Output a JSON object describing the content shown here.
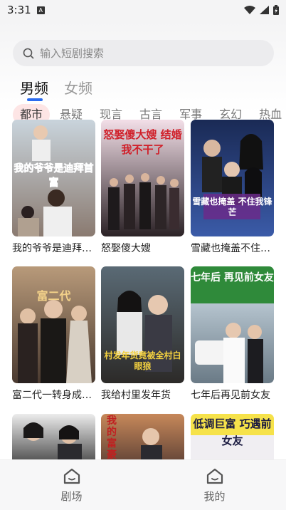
{
  "status_bar": {
    "time": "3:31",
    "notification_letter": "A"
  },
  "search": {
    "placeholder": "输入短剧搜索"
  },
  "gender_tabs": [
    {
      "label": "男频",
      "active": true
    },
    {
      "label": "女频",
      "active": false
    }
  ],
  "categories": [
    {
      "label": "都市",
      "active": true
    },
    {
      "label": "悬疑",
      "active": false
    },
    {
      "label": "现言",
      "active": false
    },
    {
      "label": "古言",
      "active": false
    },
    {
      "label": "军事",
      "active": false
    },
    {
      "label": "玄幻",
      "active": false
    },
    {
      "label": "热血",
      "active": false
    }
  ],
  "dramas": [
    {
      "title": "我的爷爷是迪拜首富",
      "poster_text": "我的爷爷是迪拜首富",
      "colors": [
        "#c9d4dc",
        "#8a7a70"
      ]
    },
    {
      "title": "怒娶傻大嫂",
      "poster_text": "怒娶傻大嫂 结婚我不干了",
      "colors": [
        "#f3dfe8",
        "#2b2226"
      ]
    },
    {
      "title": "雪藏也掩盖不住锋芒",
      "poster_text": "雪藏也掩盖 不住我锋芒",
      "colors": [
        "#1a2a55",
        "#3b5ba8"
      ]
    },
    {
      "title": "富二代一转身成了首富",
      "poster_text": "富二代",
      "colors": [
        "#b89a7a",
        "#4a3a30"
      ]
    },
    {
      "title": "我给村里发年货",
      "poster_text": "村发年货竟被全村白眼狼",
      "colors": [
        "#5a6a75",
        "#2c2a28"
      ]
    },
    {
      "title": "七年后再见前女友",
      "poster_text": "七年后 再见前女友",
      "colors": [
        "#d8e6f0",
        "#6a7a86"
      ]
    },
    {
      "title": "",
      "poster_text": "",
      "colors": [
        "#ececec",
        "#5a5a5a"
      ]
    },
    {
      "title": "",
      "poster_text": "我的富豪",
      "colors": [
        "#c7885a",
        "#6b4a3a"
      ]
    },
    {
      "title": "",
      "poster_text": "低调巨富 巧遇前女友",
      "colors": [
        "#f0eef2",
        "#3a3a4a"
      ]
    }
  ],
  "bottom_nav": [
    {
      "label": "剧场",
      "icon": "home-icon"
    },
    {
      "label": "我的",
      "icon": "home-icon"
    }
  ]
}
